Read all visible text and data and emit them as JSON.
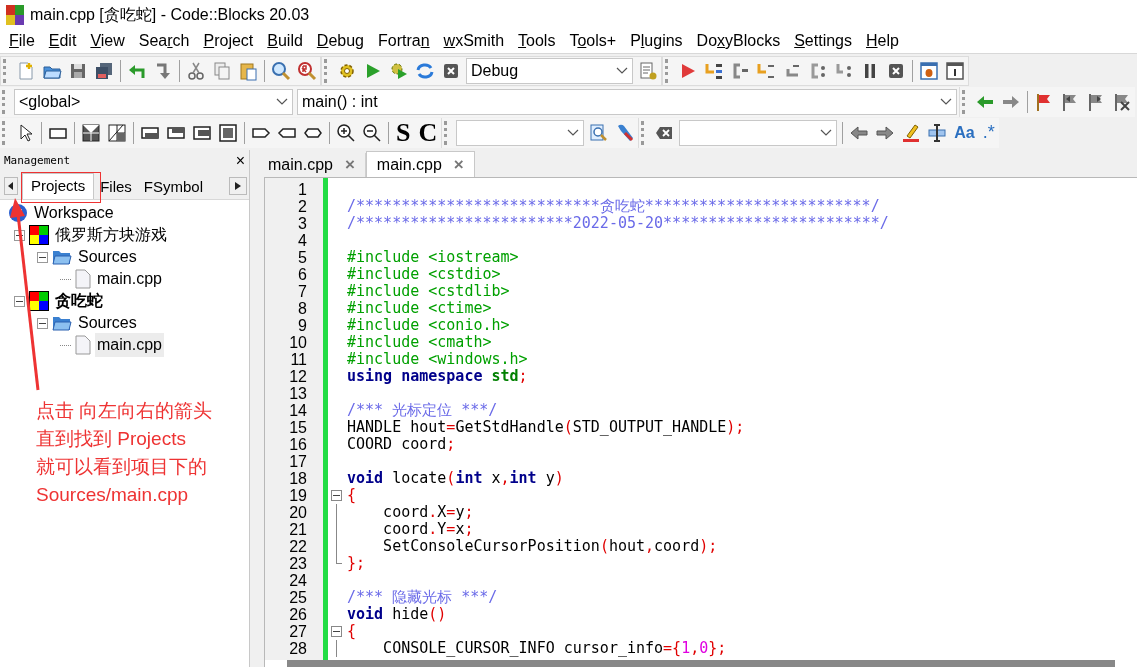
{
  "window": {
    "title": "main.cpp [贪吃蛇] - Code::Blocks 20.03"
  },
  "menu": [
    {
      "key": "F",
      "after": "ile"
    },
    {
      "key": "E",
      "after": "dit"
    },
    {
      "key": "V",
      "after": "iew"
    },
    {
      "before": "Sea",
      "key": "r",
      "after": "ch"
    },
    {
      "key": "P",
      "after": "roject"
    },
    {
      "key": "B",
      "after": "uild"
    },
    {
      "key": "D",
      "after": "ebug"
    },
    {
      "before": "Fortra",
      "key": "n"
    },
    {
      "key": "w",
      "after": "xSmith"
    },
    {
      "key": "T",
      "after": "ools"
    },
    {
      "before": "T",
      "key": "o",
      "after": "ols+"
    },
    {
      "before": "P",
      "key": "l",
      "after": "ugins"
    },
    {
      "before": "Do",
      "key": "x",
      "after": "yBlocks"
    },
    {
      "key": "S",
      "after": "ettings"
    },
    {
      "key": "H",
      "after": "elp"
    }
  ],
  "toolbar_combos": [
    {
      "value": "Debug"
    },
    {
      "value": "<global>"
    },
    {
      "value": "main() : int"
    }
  ],
  "toolbar_text_buttons": [
    "S",
    "C",
    "Aa",
    ".*"
  ],
  "management": {
    "title": "Management",
    "close": "×",
    "tabs": [
      {
        "label": "Projects",
        "selected": true
      },
      {
        "label": "Files",
        "selected": false
      },
      {
        "label": "FSymbol",
        "selected": false
      }
    ],
    "tree": [
      {
        "label": "Workspace",
        "kind": "workspace",
        "selected": false,
        "children": [
          {
            "label": "俄罗斯方块游戏",
            "kind": "project",
            "active": false,
            "expanded": true,
            "selected": false,
            "children": [
              {
                "label": "Sources",
                "kind": "folder",
                "expanded": true,
                "selected": false,
                "children": [
                  {
                    "label": "main.cpp",
                    "kind": "file",
                    "selected": false
                  }
                ]
              }
            ]
          },
          {
            "label": "贪吃蛇",
            "kind": "project",
            "active": true,
            "expanded": true,
            "selected": false,
            "children": [
              {
                "label": "Sources",
                "kind": "folder",
                "expanded": true,
                "selected": false,
                "children": [
                  {
                    "label": "main.cpp",
                    "kind": "file",
                    "selected": true
                  }
                ]
              }
            ]
          }
        ]
      }
    ]
  },
  "editor": {
    "tabs": [
      {
        "label": "main.cpp",
        "close": "×",
        "selected": false
      },
      {
        "label": "main.cpp",
        "close": "×",
        "selected": true
      }
    ],
    "lines": [
      {
        "number": "1"
      },
      {
        "number": "2",
        "tokens": [
          {
            "kind": "comment",
            "text": "/***************************贪吃蛇*************************/"
          }
        ]
      },
      {
        "number": "3",
        "tokens": [
          {
            "kind": "comment",
            "text": "/************************2022-05-20************************/"
          }
        ]
      },
      {
        "number": "4"
      },
      {
        "number": "5",
        "tokens": [
          {
            "kind": "preproc",
            "text": "#include <iostream>"
          }
        ]
      },
      {
        "number": "6",
        "tokens": [
          {
            "kind": "preproc",
            "text": "#include <cstdio>"
          }
        ]
      },
      {
        "number": "7",
        "tokens": [
          {
            "kind": "preproc",
            "text": "#include <cstdlib>"
          }
        ]
      },
      {
        "number": "8",
        "tokens": [
          {
            "kind": "preproc",
            "text": "#include <ctime>"
          }
        ]
      },
      {
        "number": "9",
        "tokens": [
          {
            "kind": "preproc",
            "text": "#include <conio.h>"
          }
        ]
      },
      {
        "number": "10",
        "tokens": [
          {
            "kind": "preproc",
            "text": "#include <cmath>"
          }
        ]
      },
      {
        "number": "11",
        "tokens": [
          {
            "kind": "preproc",
            "text": "#include <windows.h>"
          }
        ]
      },
      {
        "number": "12",
        "tokens": [
          {
            "kind": "keyword",
            "text": "using namespace"
          },
          {
            "kind": "namespace",
            "text": " std"
          },
          {
            "kind": "op",
            "text": ";"
          }
        ]
      },
      {
        "number": "13"
      },
      {
        "number": "14",
        "tokens": [
          {
            "kind": "comment",
            "text": "/*** 光标定位 ***/"
          }
        ]
      },
      {
        "number": "15",
        "tokens": [
          {
            "kind": "text",
            "text": "HANDLE hout"
          },
          {
            "kind": "op",
            "text": "="
          },
          {
            "kind": "text",
            "text": "GetStdHandle"
          },
          {
            "kind": "op",
            "text": "("
          },
          {
            "kind": "text",
            "text": "STD_OUTPUT_HANDLE"
          },
          {
            "kind": "op",
            "text": ");"
          }
        ]
      },
      {
        "number": "16",
        "tokens": [
          {
            "kind": "text",
            "text": "COORD coord"
          },
          {
            "kind": "op",
            "text": ";"
          }
        ]
      },
      {
        "number": "17"
      },
      {
        "number": "18",
        "tokens": [
          {
            "kind": "keyword",
            "text": "void"
          },
          {
            "kind": "text",
            "text": " locate"
          },
          {
            "kind": "op",
            "text": "("
          },
          {
            "kind": "keyword",
            "text": "int"
          },
          {
            "kind": "text",
            "text": " x"
          },
          {
            "kind": "op",
            "text": ","
          },
          {
            "kind": "keyword",
            "text": "int"
          },
          {
            "kind": "text",
            "text": " y"
          },
          {
            "kind": "op",
            "text": ")"
          }
        ]
      },
      {
        "number": "19",
        "fold_marker": true,
        "tokens": [
          {
            "kind": "op",
            "text": "{"
          }
        ]
      },
      {
        "number": "20",
        "fold_guide": true,
        "tokens": [
          {
            "kind": "text",
            "text": "    coord"
          },
          {
            "kind": "op",
            "text": "."
          },
          {
            "kind": "text",
            "text": "X"
          },
          {
            "kind": "op",
            "text": "="
          },
          {
            "kind": "text",
            "text": "y"
          },
          {
            "kind": "op",
            "text": ";"
          }
        ]
      },
      {
        "number": "21",
        "fold_guide": true,
        "tokens": [
          {
            "kind": "text",
            "text": "    coord"
          },
          {
            "kind": "op",
            "text": "."
          },
          {
            "kind": "text",
            "text": "Y"
          },
          {
            "kind": "op",
            "text": "="
          },
          {
            "kind": "text",
            "text": "x"
          },
          {
            "kind": "op",
            "text": ";"
          }
        ]
      },
      {
        "number": "22",
        "fold_guide": true,
        "tokens": [
          {
            "kind": "text",
            "text": "    SetConsoleCursorPosition"
          },
          {
            "kind": "op",
            "text": "("
          },
          {
            "kind": "text",
            "text": "hout"
          },
          {
            "kind": "op",
            "text": ","
          },
          {
            "kind": "text",
            "text": "coord"
          },
          {
            "kind": "op",
            "text": ");"
          }
        ]
      },
      {
        "number": "23",
        "fold_end": true,
        "tokens": [
          {
            "kind": "op",
            "text": "};"
          }
        ]
      },
      {
        "number": "24"
      },
      {
        "number": "25",
        "tokens": [
          {
            "kind": "comment",
            "text": "/*** 隐藏光标 ***/"
          }
        ]
      },
      {
        "number": "26",
        "tokens": [
          {
            "kind": "keyword",
            "text": "void"
          },
          {
            "kind": "text",
            "text": " hide"
          },
          {
            "kind": "op",
            "text": "()"
          }
        ]
      },
      {
        "number": "27",
        "fold_marker": true,
        "tokens": [
          {
            "kind": "op",
            "text": "{"
          }
        ]
      },
      {
        "number": "28",
        "fold_guide": true,
        "tokens": [
          {
            "kind": "text",
            "text": "    CONSOLE_CURSOR_INFO cursor_info"
          },
          {
            "kind": "op",
            "text": "={"
          },
          {
            "kind": "number",
            "text": "1"
          },
          {
            "kind": "op",
            "text": ","
          },
          {
            "kind": "number",
            "text": "0"
          },
          {
            "kind": "op",
            "text": "};"
          }
        ]
      }
    ]
  },
  "annotation": {
    "lines": [
      "点击 向左向右的箭头",
      "直到找到 Projects",
      "就可以看到项目下的",
      "Sources/main.cpp"
    ]
  }
}
